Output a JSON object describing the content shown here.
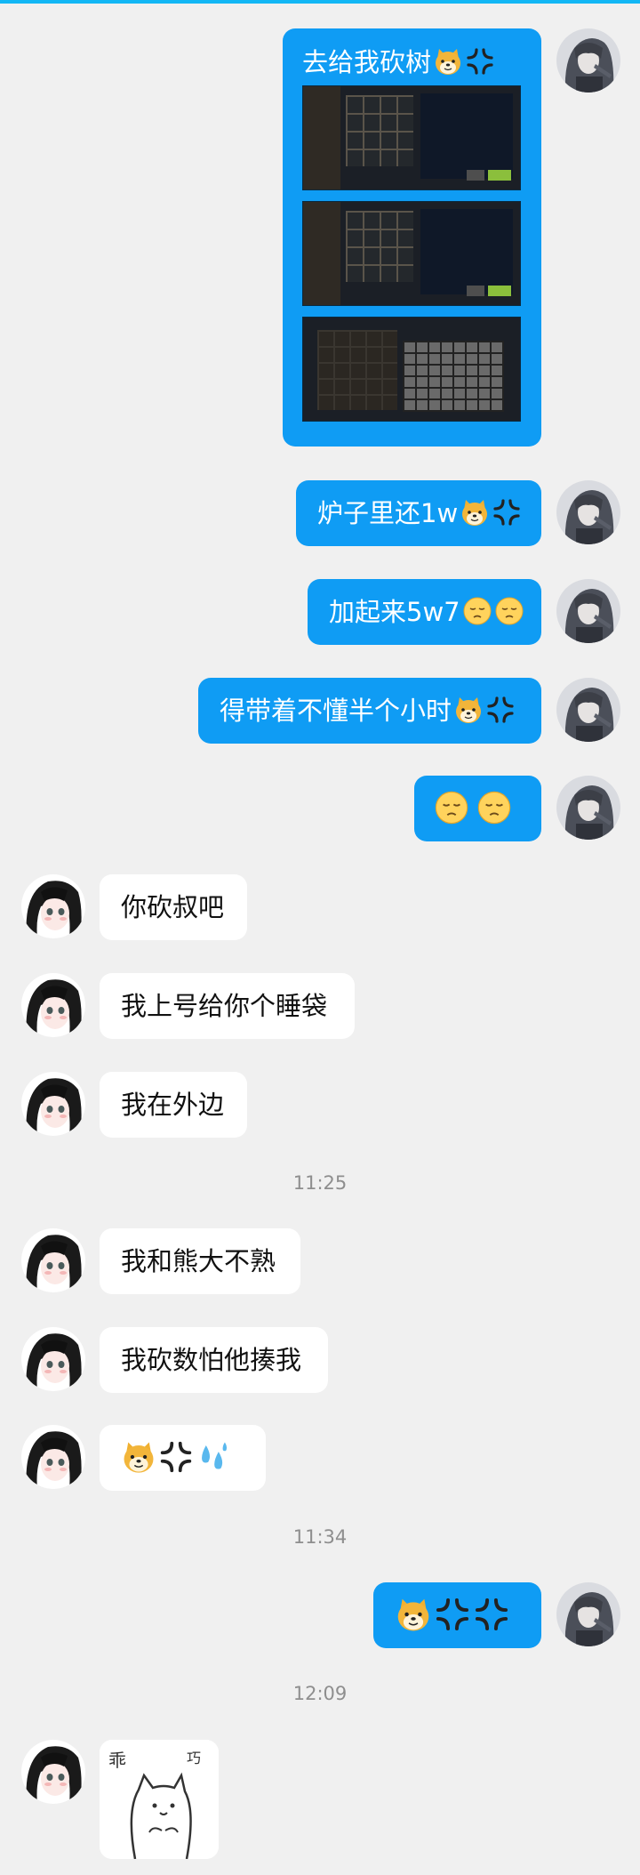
{
  "colors": {
    "my_bubble": "#0f9cf4",
    "their_bubble": "#ffffff",
    "background": "#f0f0f0",
    "timestamp": "#8e8e8e"
  },
  "messages": {
    "m1_text": "去给我砍树",
    "m2_text": "炉子里还1w",
    "m3_text": "加起来5w7",
    "m4_text": "得带着不懂半个小时",
    "m6_text": "你砍叔吧",
    "m7_text": "我上号给你个睡袋",
    "m8_text": "我在外边",
    "m9_text": "我和熊大不熟",
    "m10_text": "我砍数怕他揍我"
  },
  "timestamps": {
    "t1": "11:25",
    "t2": "11:34",
    "t3": "12:09"
  },
  "sticker": {
    "left_char": "乖",
    "right_char": "巧"
  },
  "icons": [
    "shiba-emoji-icon",
    "anger-emoji-icon",
    "sad-face-emoji-icon",
    "sweat-drops-emoji-icon",
    "avatar-self",
    "avatar-friend"
  ]
}
